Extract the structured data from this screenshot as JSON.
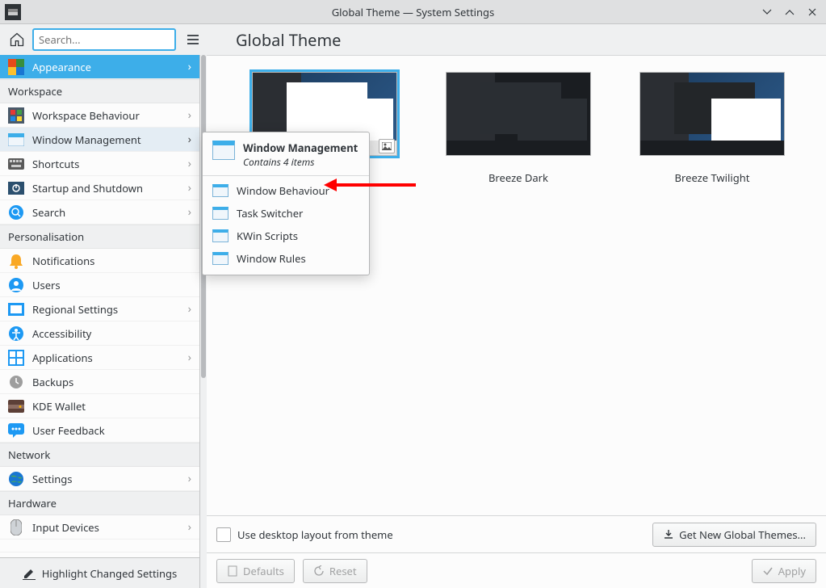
{
  "window": {
    "title": "Global Theme — System Settings"
  },
  "toolbar": {
    "search_placeholder": "Search...",
    "page_title": "Global Theme"
  },
  "sidebar": {
    "appearance": "Appearance",
    "categories": {
      "workspace": "Workspace",
      "personalisation": "Personalisation",
      "network": "Network",
      "hardware": "Hardware"
    },
    "items": {
      "workspace_behaviour": "Workspace Behaviour",
      "window_management": "Window Management",
      "shortcuts": "Shortcuts",
      "startup_shutdown": "Startup and Shutdown",
      "search": "Search",
      "notifications": "Notifications",
      "users": "Users",
      "regional": "Regional Settings",
      "accessibility": "Accessibility",
      "applications": "Applications",
      "backups": "Backups",
      "kde_wallet": "KDE Wallet",
      "user_feedback": "User Feedback",
      "net_settings": "Settings",
      "input_devices": "Input Devices"
    },
    "footer": "Highlight Changed Settings"
  },
  "themes": {
    "breeze": "",
    "breeze_dark": "Breeze Dark",
    "breeze_twilight": "Breeze Twilight"
  },
  "bottom": {
    "use_desktop_layout": "Use desktop layout from theme",
    "get_new": "Get New Global Themes...",
    "defaults": "Defaults",
    "reset": "Reset",
    "apply": "Apply"
  },
  "popup": {
    "title": "Window Management",
    "subtitle": "Contains 4 items",
    "items": {
      "window_behaviour": "Window Behaviour",
      "task_switcher": "Task Switcher",
      "kwin_scripts": "KWin Scripts",
      "window_rules": "Window Rules"
    }
  }
}
